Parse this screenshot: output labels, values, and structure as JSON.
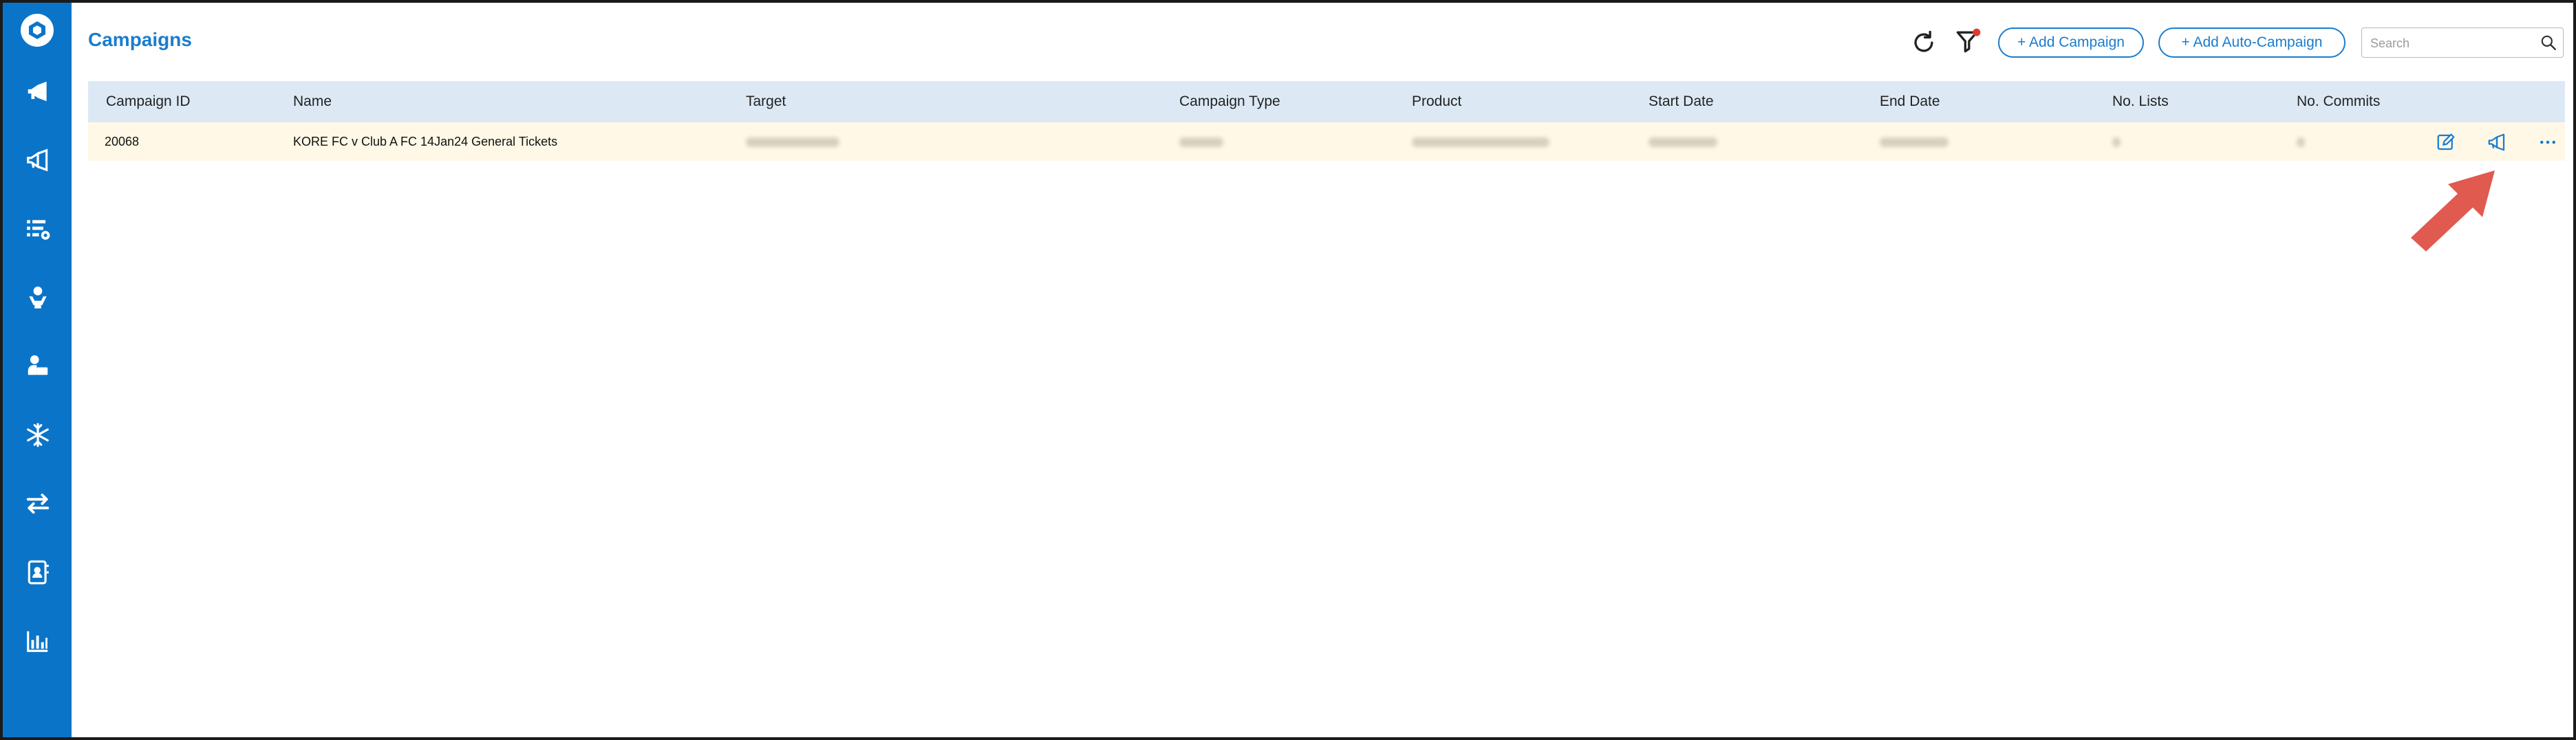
{
  "page": {
    "title": "Campaigns"
  },
  "toolbar": {
    "add_campaign_label": "+ Add Campaign",
    "add_auto_campaign_label": "+ Add Auto-Campaign",
    "search_placeholder": "Search"
  },
  "table": {
    "headers": [
      "Campaign ID",
      "Name",
      "Target",
      "Campaign Type",
      "Product",
      "Start Date",
      "End Date",
      "No. Lists",
      "No. Commits"
    ],
    "rows": [
      {
        "campaign_id": "20068",
        "name": "KORE FC v Club A FC 14Jan24 General Tickets"
      }
    ]
  },
  "sidebar": {
    "items": [
      {
        "icon": "megaphone-icon"
      },
      {
        "icon": "megaphone-outline-icon"
      },
      {
        "icon": "list-settings-icon"
      },
      {
        "icon": "person-desk-icon"
      },
      {
        "icon": "person-laptop-icon"
      },
      {
        "icon": "snowflake-icon"
      },
      {
        "icon": "transfer-arrows-icon"
      },
      {
        "icon": "contact-book-icon"
      },
      {
        "icon": "bar-chart-icon"
      }
    ]
  },
  "colors": {
    "brand_blue": "#0a74c9",
    "accent_blue": "#1a7ccd",
    "header_bg": "#dce9f5",
    "row_highlight": "#fff8e6",
    "annotation_red": "#e05a4f"
  }
}
